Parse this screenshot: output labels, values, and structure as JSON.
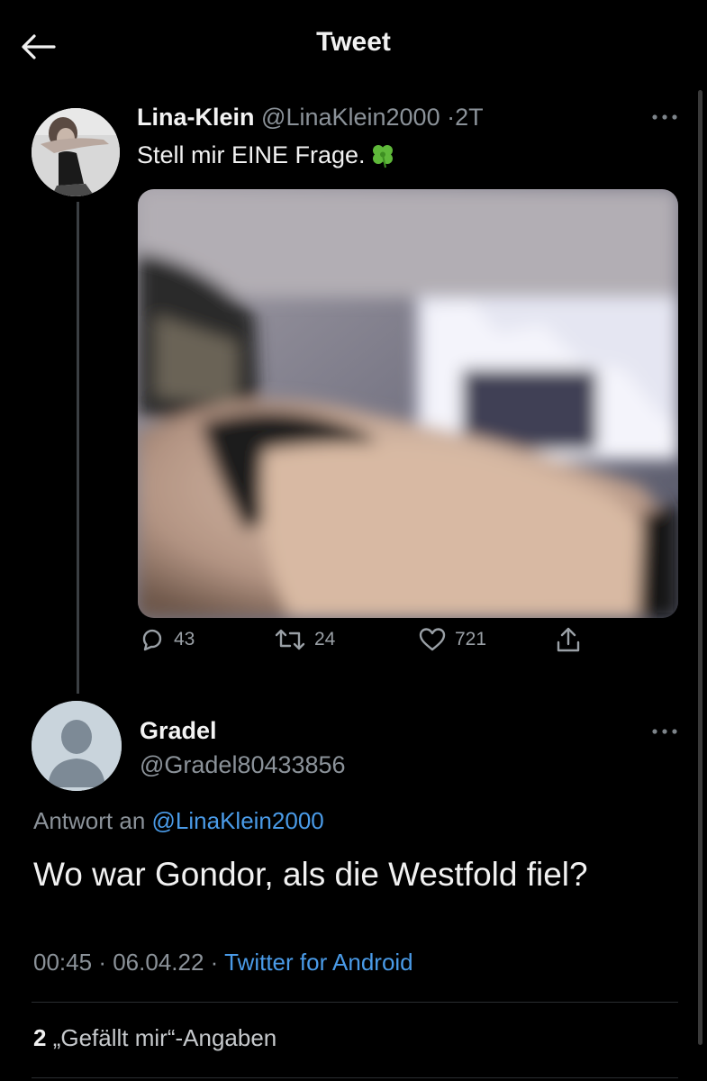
{
  "header": {
    "title": "Tweet",
    "back_icon": "arrow-left-icon"
  },
  "tweet": {
    "name": "Lina-Klein",
    "handle": "@LinaKlein2000",
    "separator": "·",
    "age": "2T",
    "text": "Stell mir EINE Frage.",
    "emoji_icon": "four-leaf-clover-icon",
    "stats": {
      "replies": "43",
      "retweets": "24",
      "likes": "721"
    }
  },
  "reply": {
    "name": "Gradel",
    "handle": "@Gradel80433856",
    "replying_to_label": "Antwort an",
    "replying_to_handle": "@LinaKlein2000",
    "text": "Wo war Gondor, als die Westfold fiel?",
    "time": "00:45",
    "dot": "·",
    "date": "06.04.22",
    "source": "Twitter for Android",
    "likes_count": "2",
    "likes_label": "„Gefällt mir“-Angaben"
  },
  "colors": {
    "background": "#000000",
    "accent_link": "#4a9be8",
    "secondary_text": "#8b9299",
    "primary_text": "#e7e9ea"
  }
}
